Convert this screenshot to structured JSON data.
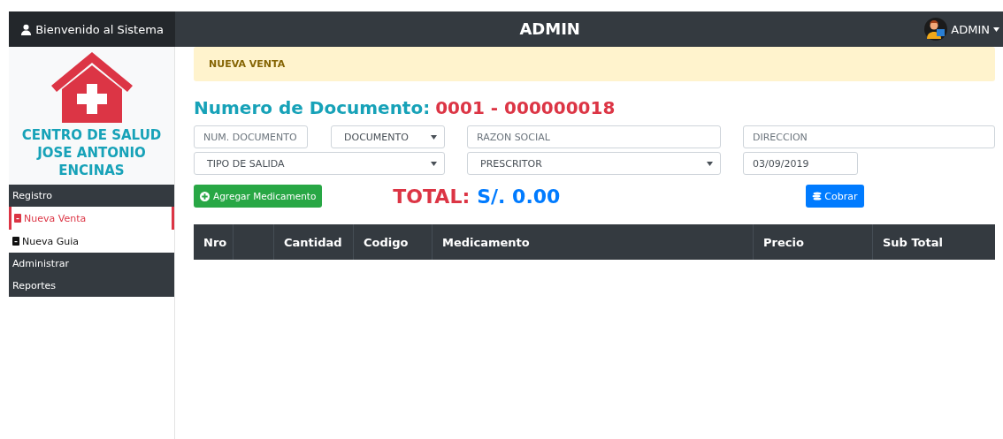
{
  "topbar": {
    "welcome": "Bienvenido al Sistema",
    "title": "ADMIN",
    "user": "ADMIN"
  },
  "sidebar": {
    "brand": "CENTRO DE SALUD JOSE ANTONIO ENCINAS",
    "menu": [
      {
        "label": "Registro",
        "children": [
          {
            "label": "Nueva Venta",
            "selected": true
          },
          {
            "label": "Nueva Guia",
            "selected": false
          }
        ]
      },
      {
        "label": "Administrar"
      },
      {
        "label": "Reportes"
      }
    ]
  },
  "alert": "NUEVA VENTA",
  "document": {
    "label": "Numero de Documento:",
    "number": "0001 - 000000018"
  },
  "form": {
    "num_documento": {
      "placeholder": "NUM. DOCUMENTO"
    },
    "documento": {
      "value": "DOCUMENTO"
    },
    "razon_social": {
      "placeholder": "RAZON SOCIAL"
    },
    "direccion": {
      "placeholder": "DIRECCION"
    },
    "tipo_salida": {
      "value": "TIPO DE SALIDA"
    },
    "prescritor": {
      "value": "PRESCRITOR"
    },
    "fecha": {
      "value": "03/09/2019"
    }
  },
  "add_button": "Agregar Medicamento",
  "total": {
    "label": "TOTAL:",
    "amount": "S/. 0.00"
  },
  "charge_button": "Cobrar",
  "table": {
    "columns": [
      "Nro",
      "",
      "Cantidad",
      "Codigo",
      "Medicamento",
      "Precio",
      "Sub Total"
    ]
  }
}
